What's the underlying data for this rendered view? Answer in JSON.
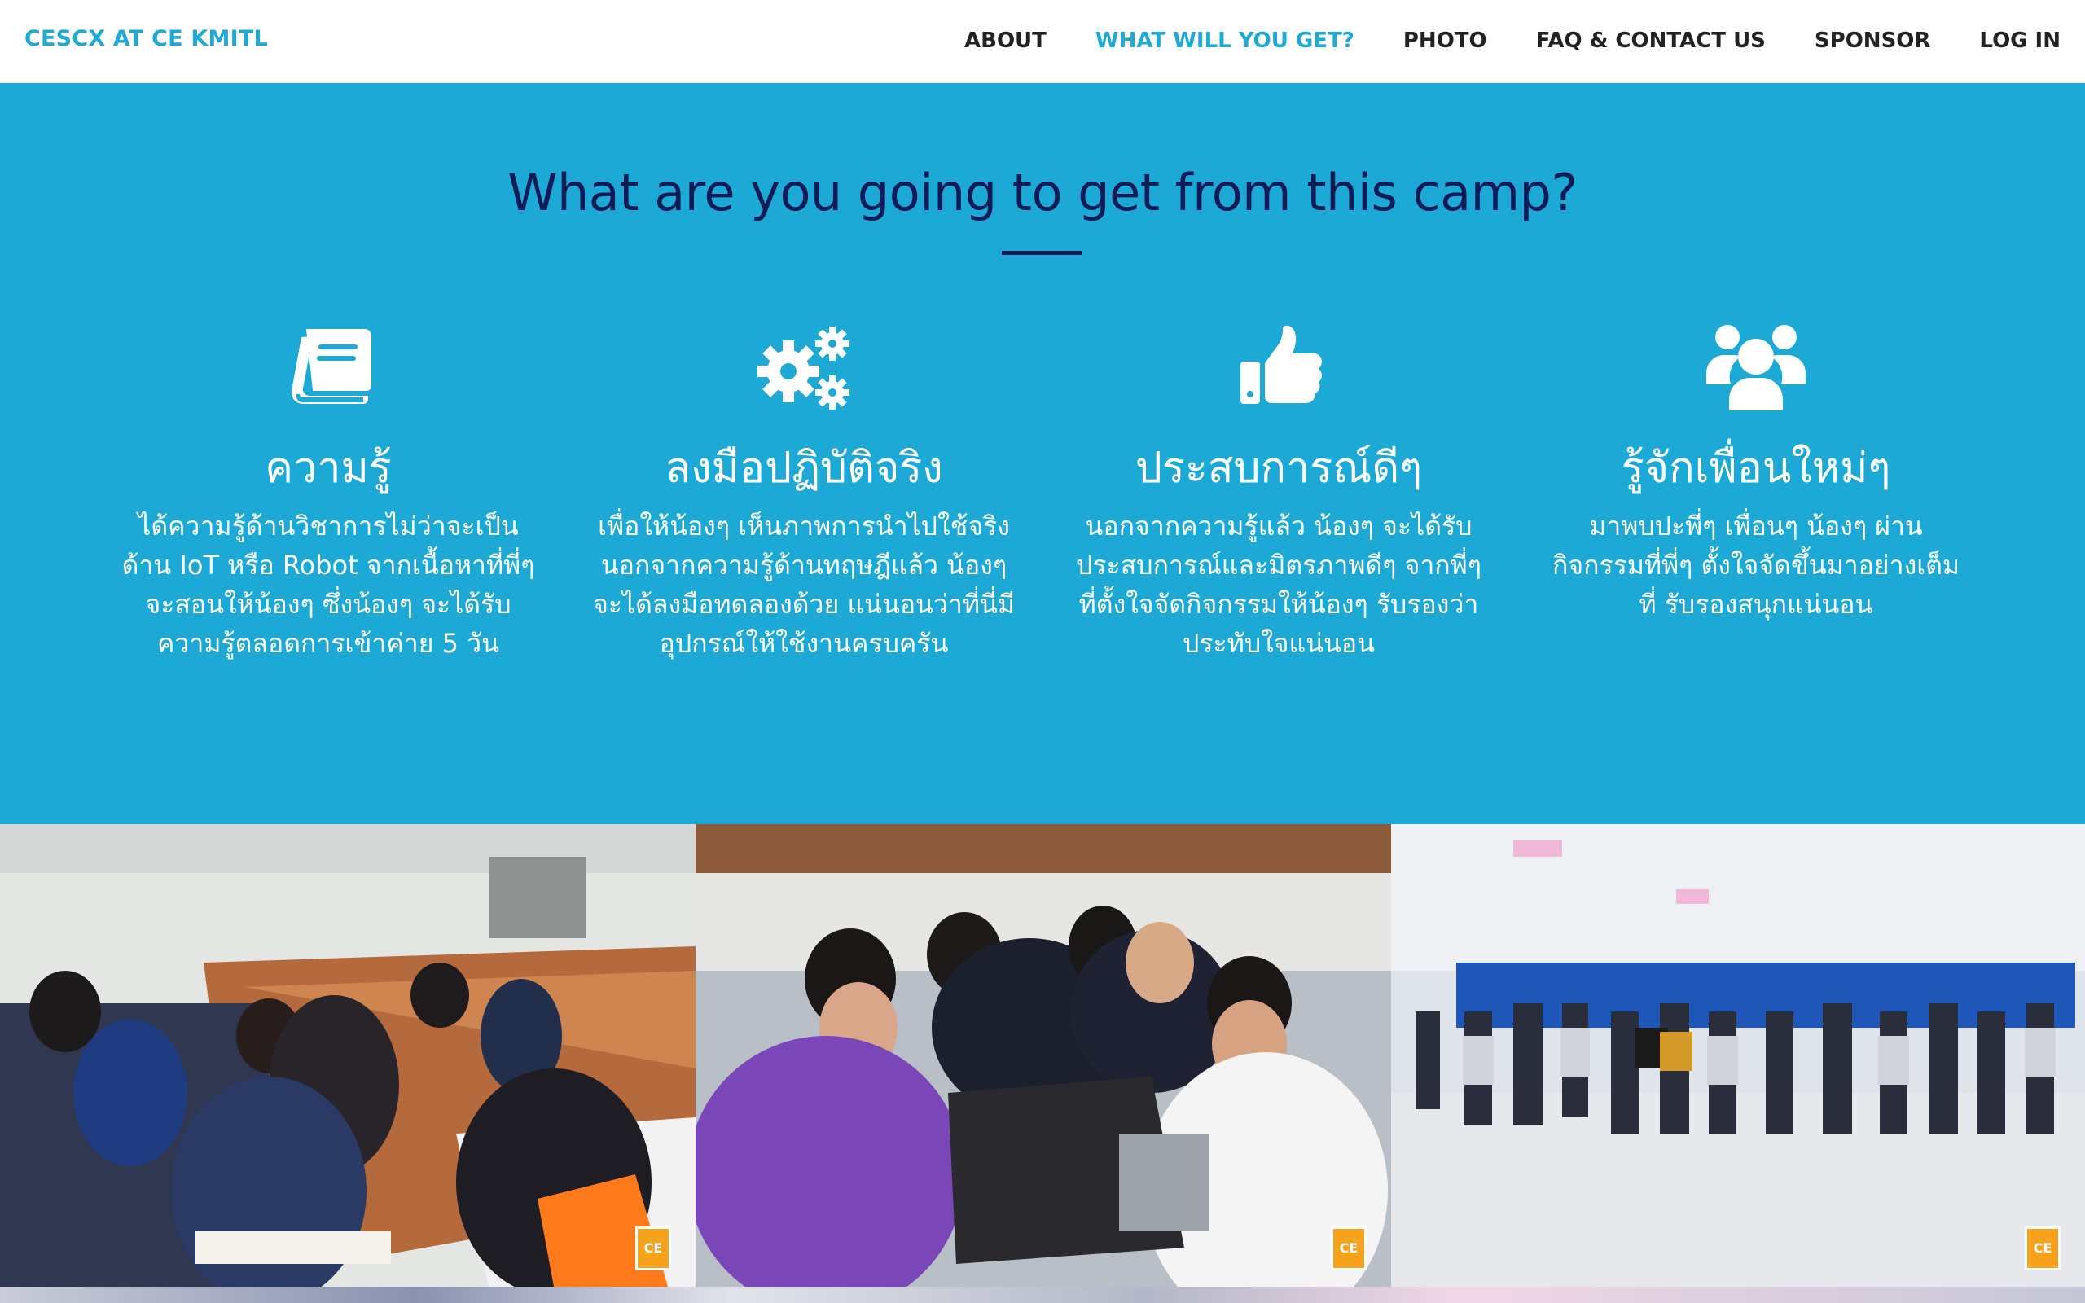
{
  "brand": "CESCX AT CE KMITL",
  "nav": {
    "items": [
      {
        "label": "ABOUT",
        "active": false
      },
      {
        "label": "WHAT WILL YOU GET?",
        "active": true
      },
      {
        "label": "PHOTO",
        "active": false
      },
      {
        "label": "FAQ & CONTACT US",
        "active": false
      },
      {
        "label": "SPONSOR",
        "active": false
      },
      {
        "label": "LOG IN",
        "active": false
      }
    ]
  },
  "features": {
    "title": "What are you going to get from this camp?",
    "items": [
      {
        "icon": "book-icon",
        "title": "ความรู้",
        "desc": "ได้ความรู้ด้านวิชาการไม่ว่าจะเป็นด้าน IoT หรือ Robot จากเนื้อหาที่พี่ๆ จะสอนให้น้องๆ ซึ่งน้องๆ จะได้รับความรู้ตลอดการเข้าค่าย 5 วัน"
      },
      {
        "icon": "gears-icon",
        "title": "ลงมือปฏิบัติจริง",
        "desc": "เพื่อให้น้องๆ เห็นภาพการนำไปใช้จริง นอกจากความรู้ด้านทฤษฎีแล้ว น้องๆ จะได้ลงมือทดลองด้วย แน่นอนว่าที่นี่มีอุปกรณ์ให้ใช้งานครบครัน"
      },
      {
        "icon": "thumbs-up-icon",
        "title": "ประสบการณ์ดีๆ",
        "desc": "นอกจากความรู้แล้ว น้องๆ จะได้รับประสบการณ์และมิตรภาพดีๆ จากพี่ๆ ที่ตั้งใจจัดกิจกรรมให้น้องๆ รับรองว่าประทับใจแน่นอน"
      },
      {
        "icon": "users-icon",
        "title": "รู้จักเพื่อนใหม่ๆ",
        "desc": "มาพบปะพี่ๆ เพื่อนๆ น้องๆ ผ่านกิจกรรมที่พี่ๆ ตั้งใจจัดขึ้นมาอย่างเต็มที่ รับรองสนุกแน่นอน"
      }
    ]
  },
  "photos": {
    "badge_text": "CE"
  },
  "colors": {
    "accent": "#1fa9d4",
    "section_bg": "#1ca9d6",
    "title": "#0f1b57"
  }
}
